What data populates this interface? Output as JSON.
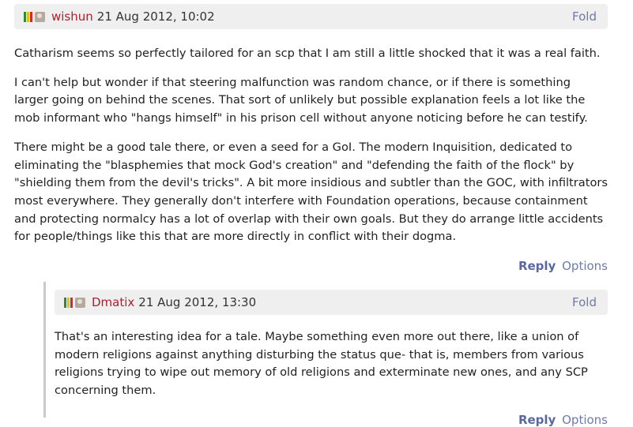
{
  "comments": [
    {
      "author": "wishun",
      "date": "21 Aug 2012, 10:02",
      "fold_label": "Fold",
      "paragraphs": [
        "Catharism seems so perfectly tailored for an scp that I am still a little shocked that it was a real faith.",
        "I can't help but wonder if that steering malfunction was random chance, or if there is something larger going on behind the scenes. That sort of unlikely but possible explanation feels a lot like the mob informant who \"hangs himself\" in his prison cell without anyone noticing before he can testify.",
        "There might be a good tale there, or even a seed for a GoI. The modern Inquisition, dedicated to eliminating the \"blasphemies that mock God's creation\" and \"defending the faith of the flock\" by \"shielding them from the devil's tricks\". A bit more insidious and subtler than the GOC, with infiltrators most everywhere. They generally don't interfere with Foundation operations, because containment and protecting normalcy has a lot of overlap with their own goals. But they do arrange little accidents for people/things like this that are more directly in conflict with their dogma."
      ],
      "reply_label": "Reply",
      "options_label": "Options"
    },
    {
      "author": "Dmatix",
      "date": "21 Aug 2012, 13:30",
      "fold_label": "Fold",
      "paragraphs": [
        "That's an interesting idea for a tale. Maybe something even more out there, like a union of modern religions against anything disturbing the status que- that is, members from various religions trying to wipe out memory of old religions and exterminate new ones, and any SCP concerning them."
      ],
      "reply_label": "Reply",
      "options_label": "Options"
    }
  ],
  "icons": {
    "rank_bar_colors": [
      "#2e8b2e",
      "#e2c21a",
      "#d9262a"
    ],
    "avatar_icon": "user-avatar-icon"
  }
}
